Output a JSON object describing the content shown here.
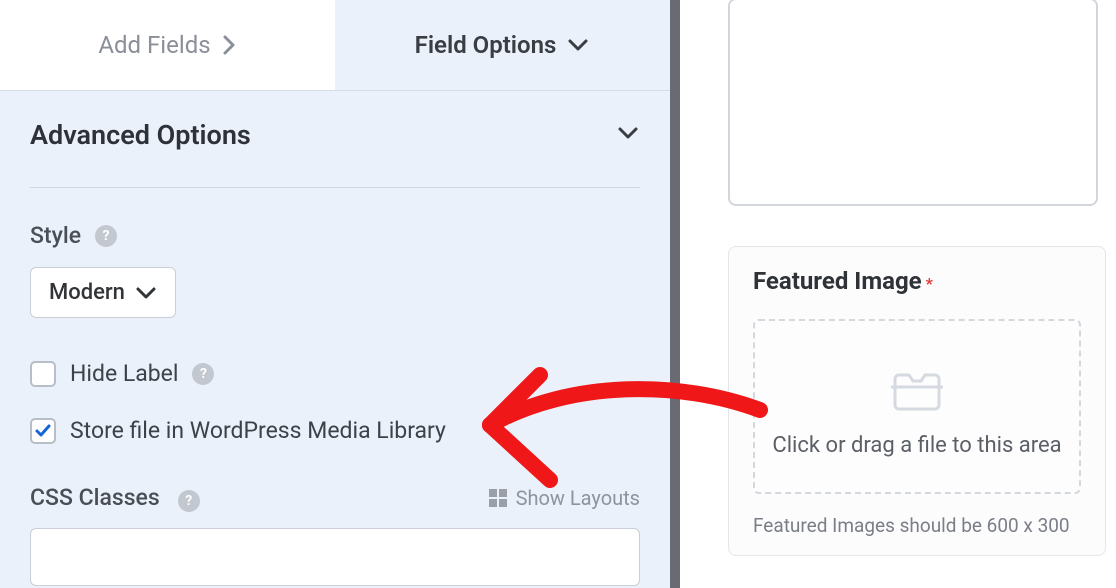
{
  "tabs": {
    "add_fields": "Add Fields",
    "field_options": "Field Options"
  },
  "advanced": {
    "title": "Advanced Options",
    "style_label": "Style",
    "style_value": "Modern",
    "hide_label": "Hide Label",
    "store_file": "Store file in WordPress Media Library",
    "css_classes": "CSS Classes",
    "show_layouts": "Show Layouts"
  },
  "preview": {
    "featured_title": "Featured Image",
    "drop_text": "Click or drag a file to this area",
    "hint": "Featured Images should be 600 x 300"
  },
  "icons": {
    "chevron_right": "›",
    "help": "?"
  },
  "colors": {
    "panel_bg": "#eaf1fb",
    "arrow": "#ef1717"
  }
}
